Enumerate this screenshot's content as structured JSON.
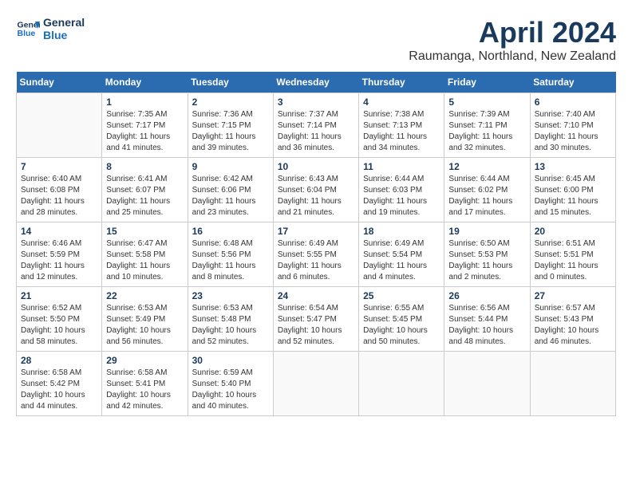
{
  "logo": {
    "line1": "General",
    "line2": "Blue"
  },
  "title": "April 2024",
  "subtitle": "Raumanga, Northland, New Zealand",
  "weekdays": [
    "Sunday",
    "Monday",
    "Tuesday",
    "Wednesday",
    "Thursday",
    "Friday",
    "Saturday"
  ],
  "weeks": [
    [
      {
        "day": "",
        "info": ""
      },
      {
        "day": "1",
        "info": "Sunrise: 7:35 AM\nSunset: 7:17 PM\nDaylight: 11 hours\nand 41 minutes."
      },
      {
        "day": "2",
        "info": "Sunrise: 7:36 AM\nSunset: 7:15 PM\nDaylight: 11 hours\nand 39 minutes."
      },
      {
        "day": "3",
        "info": "Sunrise: 7:37 AM\nSunset: 7:14 PM\nDaylight: 11 hours\nand 36 minutes."
      },
      {
        "day": "4",
        "info": "Sunrise: 7:38 AM\nSunset: 7:13 PM\nDaylight: 11 hours\nand 34 minutes."
      },
      {
        "day": "5",
        "info": "Sunrise: 7:39 AM\nSunset: 7:11 PM\nDaylight: 11 hours\nand 32 minutes."
      },
      {
        "day": "6",
        "info": "Sunrise: 7:40 AM\nSunset: 7:10 PM\nDaylight: 11 hours\nand 30 minutes."
      }
    ],
    [
      {
        "day": "7",
        "info": "Sunrise: 6:40 AM\nSunset: 6:08 PM\nDaylight: 11 hours\nand 28 minutes."
      },
      {
        "day": "8",
        "info": "Sunrise: 6:41 AM\nSunset: 6:07 PM\nDaylight: 11 hours\nand 25 minutes."
      },
      {
        "day": "9",
        "info": "Sunrise: 6:42 AM\nSunset: 6:06 PM\nDaylight: 11 hours\nand 23 minutes."
      },
      {
        "day": "10",
        "info": "Sunrise: 6:43 AM\nSunset: 6:04 PM\nDaylight: 11 hours\nand 21 minutes."
      },
      {
        "day": "11",
        "info": "Sunrise: 6:44 AM\nSunset: 6:03 PM\nDaylight: 11 hours\nand 19 minutes."
      },
      {
        "day": "12",
        "info": "Sunrise: 6:44 AM\nSunset: 6:02 PM\nDaylight: 11 hours\nand 17 minutes."
      },
      {
        "day": "13",
        "info": "Sunrise: 6:45 AM\nSunset: 6:00 PM\nDaylight: 11 hours\nand 15 minutes."
      }
    ],
    [
      {
        "day": "14",
        "info": "Sunrise: 6:46 AM\nSunset: 5:59 PM\nDaylight: 11 hours\nand 12 minutes."
      },
      {
        "day": "15",
        "info": "Sunrise: 6:47 AM\nSunset: 5:58 PM\nDaylight: 11 hours\nand 10 minutes."
      },
      {
        "day": "16",
        "info": "Sunrise: 6:48 AM\nSunset: 5:56 PM\nDaylight: 11 hours\nand 8 minutes."
      },
      {
        "day": "17",
        "info": "Sunrise: 6:49 AM\nSunset: 5:55 PM\nDaylight: 11 hours\nand 6 minutes."
      },
      {
        "day": "18",
        "info": "Sunrise: 6:49 AM\nSunset: 5:54 PM\nDaylight: 11 hours\nand 4 minutes."
      },
      {
        "day": "19",
        "info": "Sunrise: 6:50 AM\nSunset: 5:53 PM\nDaylight: 11 hours\nand 2 minutes."
      },
      {
        "day": "20",
        "info": "Sunrise: 6:51 AM\nSunset: 5:51 PM\nDaylight: 11 hours\nand 0 minutes."
      }
    ],
    [
      {
        "day": "21",
        "info": "Sunrise: 6:52 AM\nSunset: 5:50 PM\nDaylight: 10 hours\nand 58 minutes."
      },
      {
        "day": "22",
        "info": "Sunrise: 6:53 AM\nSunset: 5:49 PM\nDaylight: 10 hours\nand 56 minutes."
      },
      {
        "day": "23",
        "info": "Sunrise: 6:53 AM\nSunset: 5:48 PM\nDaylight: 10 hours\nand 52 minutes."
      },
      {
        "day": "24",
        "info": "Sunrise: 6:54 AM\nSunset: 5:47 PM\nDaylight: 10 hours\nand 52 minutes."
      },
      {
        "day": "25",
        "info": "Sunrise: 6:55 AM\nSunset: 5:45 PM\nDaylight: 10 hours\nand 50 minutes."
      },
      {
        "day": "26",
        "info": "Sunrise: 6:56 AM\nSunset: 5:44 PM\nDaylight: 10 hours\nand 48 minutes."
      },
      {
        "day": "27",
        "info": "Sunrise: 6:57 AM\nSunset: 5:43 PM\nDaylight: 10 hours\nand 46 minutes."
      }
    ],
    [
      {
        "day": "28",
        "info": "Sunrise: 6:58 AM\nSunset: 5:42 PM\nDaylight: 10 hours\nand 44 minutes."
      },
      {
        "day": "29",
        "info": "Sunrise: 6:58 AM\nSunset: 5:41 PM\nDaylight: 10 hours\nand 42 minutes."
      },
      {
        "day": "30",
        "info": "Sunrise: 6:59 AM\nSunset: 5:40 PM\nDaylight: 10 hours\nand 40 minutes."
      },
      {
        "day": "",
        "info": ""
      },
      {
        "day": "",
        "info": ""
      },
      {
        "day": "",
        "info": ""
      },
      {
        "day": "",
        "info": ""
      }
    ]
  ]
}
